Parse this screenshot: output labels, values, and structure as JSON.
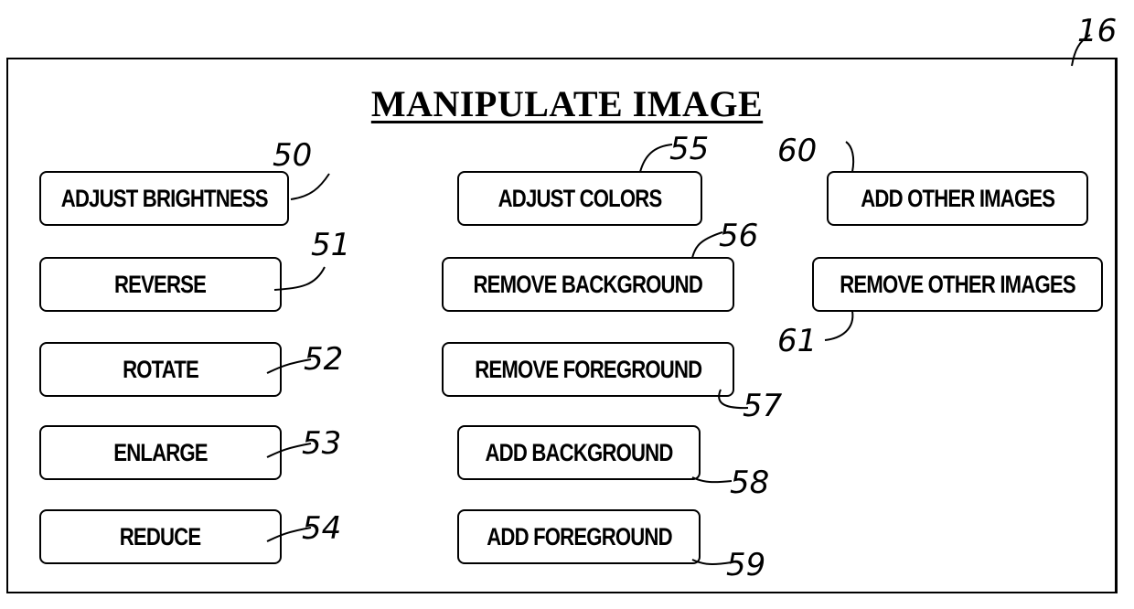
{
  "figure_ref": "16",
  "title": "MANIPULATE IMAGE",
  "columns": [
    {
      "buttons": [
        {
          "label": "ADJUST BRIGHTNESS",
          "ref": "50"
        },
        {
          "label": "REVERSE",
          "ref": "51"
        },
        {
          "label": "ROTATE",
          "ref": "52"
        },
        {
          "label": "ENLARGE",
          "ref": "53"
        },
        {
          "label": "REDUCE",
          "ref": "54"
        }
      ]
    },
    {
      "buttons": [
        {
          "label": "ADJUST COLORS",
          "ref": "55"
        },
        {
          "label": "REMOVE BACKGROUND",
          "ref": "56"
        },
        {
          "label": "REMOVE FOREGROUND",
          "ref": "57"
        },
        {
          "label": "ADD BACKGROUND",
          "ref": "58"
        },
        {
          "label": "ADD FOREGROUND",
          "ref": "59"
        }
      ]
    },
    {
      "buttons": [
        {
          "label": "ADD OTHER IMAGES",
          "ref": "60"
        },
        {
          "label": "REMOVE OTHER IMAGES",
          "ref": "61"
        }
      ]
    }
  ]
}
